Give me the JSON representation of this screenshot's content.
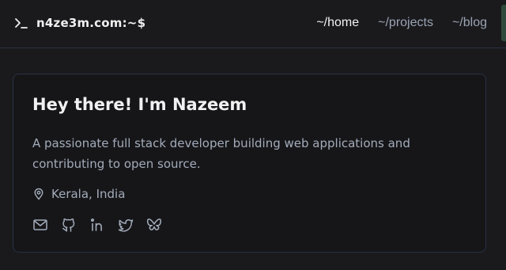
{
  "header": {
    "brand": "n4ze3m.com:~$",
    "nav": [
      {
        "label": "~/home",
        "active": true
      },
      {
        "label": "~/projects",
        "active": false
      },
      {
        "label": "~/blog",
        "active": false
      }
    ]
  },
  "profile": {
    "heading": "Hey there! I'm Nazeem",
    "description": "A passionate full stack developer building web applications and contributing to open source.",
    "location": "Kerala, India",
    "socials": [
      "mail-icon",
      "github-icon",
      "linkedin-icon",
      "twitter-icon",
      "bluesky-icon"
    ]
  },
  "colors": {
    "background": "#1a1a1d",
    "card_border": "#283142",
    "text_primary": "#f1f1f1",
    "text_muted": "#a3acba"
  }
}
